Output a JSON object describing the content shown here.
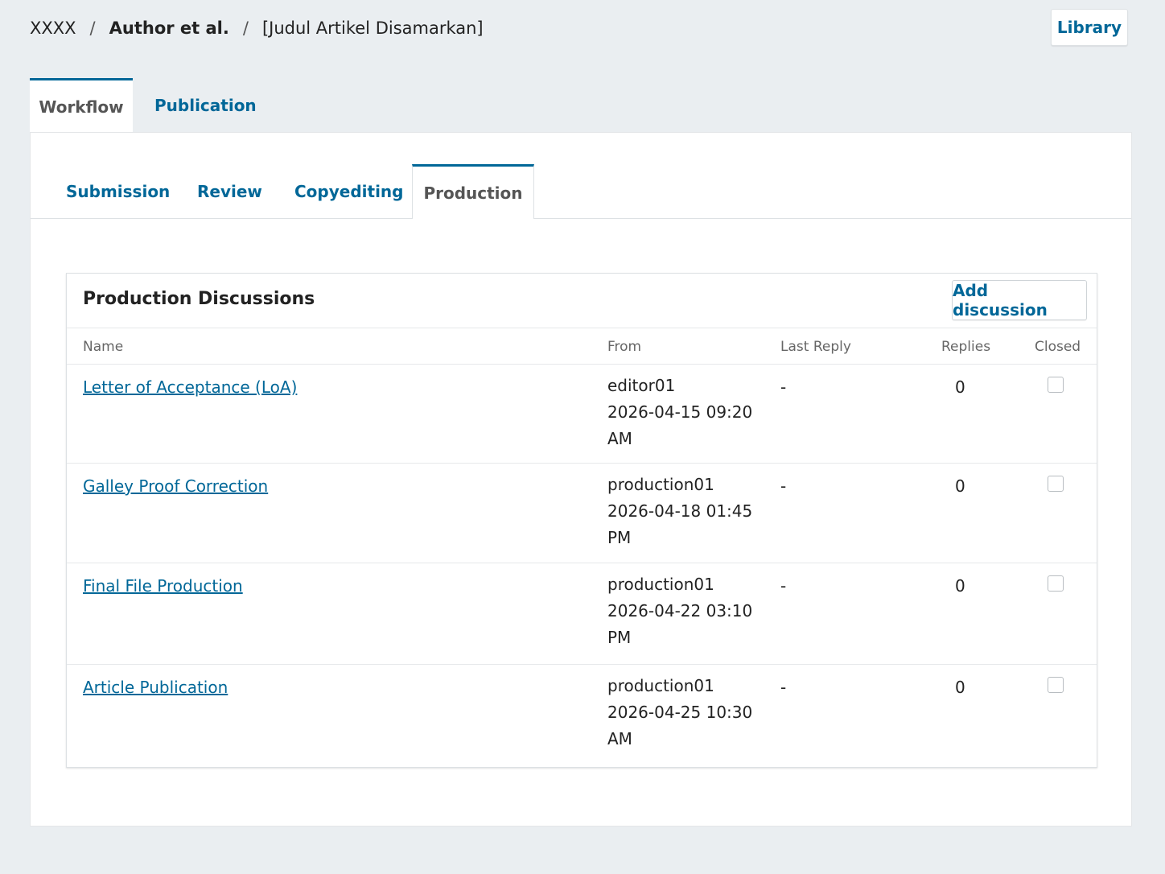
{
  "breadcrumb": {
    "context": "XXXX",
    "author": "Author et al.",
    "title": "[Judul Artikel Disamarkan]",
    "separator": "/"
  },
  "header": {
    "library_label": "Library"
  },
  "top_tabs": {
    "workflow": "Workflow",
    "publication": "Publication"
  },
  "stage_tabs": {
    "submission": "Submission",
    "review": "Review",
    "copyediting": "Copyediting",
    "production": "Production"
  },
  "discussions": {
    "title": "Production Discussions",
    "add_label": "Add discussion",
    "columns": {
      "name": "Name",
      "from": "From",
      "last_reply": "Last Reply",
      "replies": "Replies",
      "closed": "Closed"
    },
    "rows": [
      {
        "name": "Letter of Acceptance (LoA)",
        "from_user": "editor01",
        "from_date": "2026-04-15 09:20",
        "from_ampm": "AM",
        "last_reply": "-",
        "replies": "0",
        "closed": false
      },
      {
        "name": "Galley Proof Correction",
        "from_user": "production01",
        "from_date": "2026-04-18 01:45",
        "from_ampm": "PM",
        "last_reply": "-",
        "replies": "0",
        "closed": false
      },
      {
        "name": "Final File Production",
        "from_user": "production01",
        "from_date": "2026-04-22 03:10",
        "from_ampm": "PM",
        "last_reply": "-",
        "replies": "0",
        "closed": false
      },
      {
        "name": "Article Publication",
        "from_user": "production01",
        "from_date": "2026-04-25 10:30",
        "from_ampm": "AM",
        "last_reply": "-",
        "replies": "0",
        "closed": false
      }
    ]
  },
  "colors": {
    "link": "#006798",
    "background": "#eaeef1",
    "panel": "#ffffff"
  }
}
